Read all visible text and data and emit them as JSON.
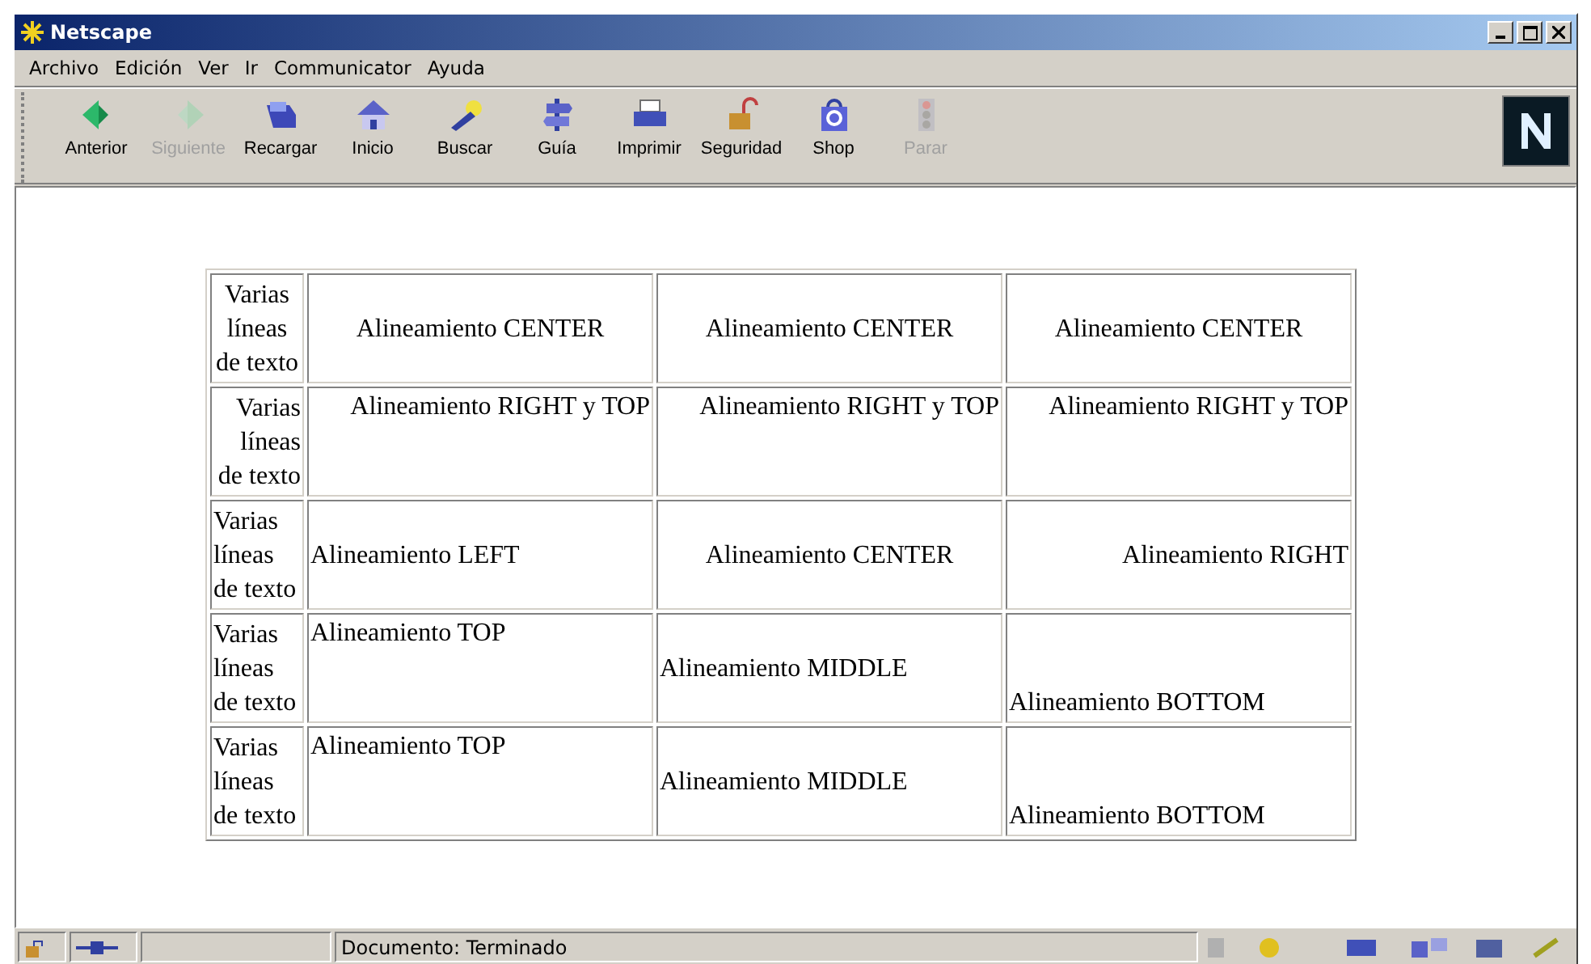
{
  "window": {
    "title": "Netscape"
  },
  "menu": [
    "Archivo",
    "Edición",
    "Ver",
    "Ir",
    "Communicator",
    "Ayuda"
  ],
  "toolbar": [
    {
      "label": "Anterior",
      "disabled": false
    },
    {
      "label": "Siguiente",
      "disabled": true
    },
    {
      "label": "Recargar",
      "disabled": false
    },
    {
      "label": "Inicio",
      "disabled": false
    },
    {
      "label": "Buscar",
      "disabled": false
    },
    {
      "label": "Guía",
      "disabled": false
    },
    {
      "label": "Imprimir",
      "disabled": false
    },
    {
      "label": "Seguridad",
      "disabled": false
    },
    {
      "label": "Shop",
      "disabled": false
    },
    {
      "label": "Parar",
      "disabled": true
    }
  ],
  "table": {
    "rows": [
      {
        "header": {
          "text": "Varias líneas de texto",
          "kind": "center"
        },
        "cells": [
          {
            "text": "Alineamiento CENTER",
            "kind": "center"
          },
          {
            "text": "Alineamiento CENTER",
            "kind": "center"
          },
          {
            "text": "Alineamiento CENTER",
            "kind": "center"
          }
        ]
      },
      {
        "header": {
          "text": "Varias líneas de texto",
          "kind": "right"
        },
        "cells": [
          {
            "text": "Alineamiento RIGHT y TOP",
            "kind": "righttop"
          },
          {
            "text": "Alineamiento RIGHT y TOP",
            "kind": "righttop"
          },
          {
            "text": "Alineamiento RIGHT y TOP",
            "kind": "righttop"
          }
        ]
      },
      {
        "header": {
          "text": "Varias líneas de texto",
          "kind": "left"
        },
        "cells": [
          {
            "text": "Alineamiento LEFT",
            "kind": "left"
          },
          {
            "text": "Alineamiento CENTER",
            "kind": "center"
          },
          {
            "text": "Alineamiento RIGHT",
            "kind": "right"
          }
        ]
      },
      {
        "header": {
          "text": "Varias líneas de texto",
          "kind": "left"
        },
        "cells": [
          {
            "text": "Alineamiento TOP",
            "kind": "top"
          },
          {
            "text": "Alineamiento MIDDLE",
            "kind": "middle"
          },
          {
            "text": "Alineamiento BOTTOM",
            "kind": "bottom"
          }
        ]
      },
      {
        "header": {
          "text": "Varias líneas de texto",
          "kind": "left"
        },
        "cells": [
          {
            "text": "Alineamiento TOP",
            "kind": "top"
          },
          {
            "text": "Alineamiento MIDDLE",
            "kind": "middle"
          },
          {
            "text": "Alineamiento BOTTOM",
            "kind": "bottom"
          }
        ]
      }
    ]
  },
  "status_bar": {
    "text": "Documento: Terminado"
  }
}
